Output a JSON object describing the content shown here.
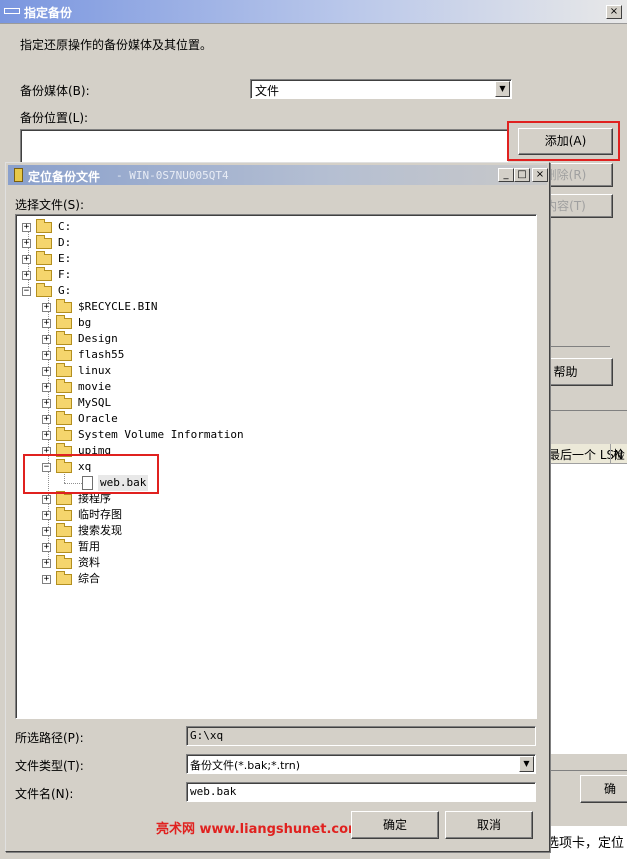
{
  "outer": {
    "title": "指定备份",
    "close": "×",
    "description": "指定还原操作的备份媒体及其位置。",
    "media_label": "备份媒体(B):",
    "media_value": "文件",
    "location_label": "备份位置(L):",
    "add_button": "添加(A)",
    "delete_button": "删除(R)",
    "contents_button": "内容(T)",
    "help_button": "帮助",
    "lsn_header": "最后一个 LSN",
    "check_header": "检",
    "ok_button": "确",
    "bottom_text": "选项卡，定位"
  },
  "inner": {
    "title": "定位备份文件",
    "title_suffix": "- WIN-0S7NU005QT4",
    "minimize": "_",
    "maximize": "□",
    "close": "×",
    "select_label": "选择文件(S):",
    "tree": [
      {
        "label": "C:",
        "expander": "+"
      },
      {
        "label": "D:",
        "expander": "+"
      },
      {
        "label": "E:",
        "expander": "+"
      },
      {
        "label": "F:",
        "expander": "+"
      },
      {
        "label": "G:",
        "expander": "−"
      },
      {
        "label": "$RECYCLE.BIN",
        "expander": "+"
      },
      {
        "label": "bg",
        "expander": "+"
      },
      {
        "label": "Design",
        "expander": "+"
      },
      {
        "label": "flash55",
        "expander": "+"
      },
      {
        "label": "linux",
        "expander": "+"
      },
      {
        "label": "movie",
        "expander": "+"
      },
      {
        "label": "MySQL",
        "expander": "+"
      },
      {
        "label": "Oracle",
        "expander": "+"
      },
      {
        "label": "System Volume Information",
        "expander": "+"
      },
      {
        "label": "upimg",
        "expander": "+"
      },
      {
        "label": "xq",
        "expander": "−"
      },
      {
        "label": "web.bak"
      },
      {
        "label": "接程序",
        "expander": "+"
      },
      {
        "label": "临时存图",
        "expander": "+"
      },
      {
        "label": "搜索发现",
        "expander": "+"
      },
      {
        "label": "暂用",
        "expander": "+"
      },
      {
        "label": "资料",
        "expander": "+"
      },
      {
        "label": "综合",
        "expander": "+"
      }
    ],
    "path_label": "所选路径(P):",
    "path_value": "G:\\xq",
    "filetype_label": "文件类型(T):",
    "filetype_value": "备份文件(*.bak;*.trn)",
    "filename_label": "文件名(N):",
    "filename_value": "web.bak",
    "ok_button": "确定",
    "cancel_button": "取消",
    "watermark": "亮术网 www.liangshunet.com"
  },
  "colors": {
    "highlight": "#e0211f",
    "dialog_bg": "#d4d0c8"
  }
}
